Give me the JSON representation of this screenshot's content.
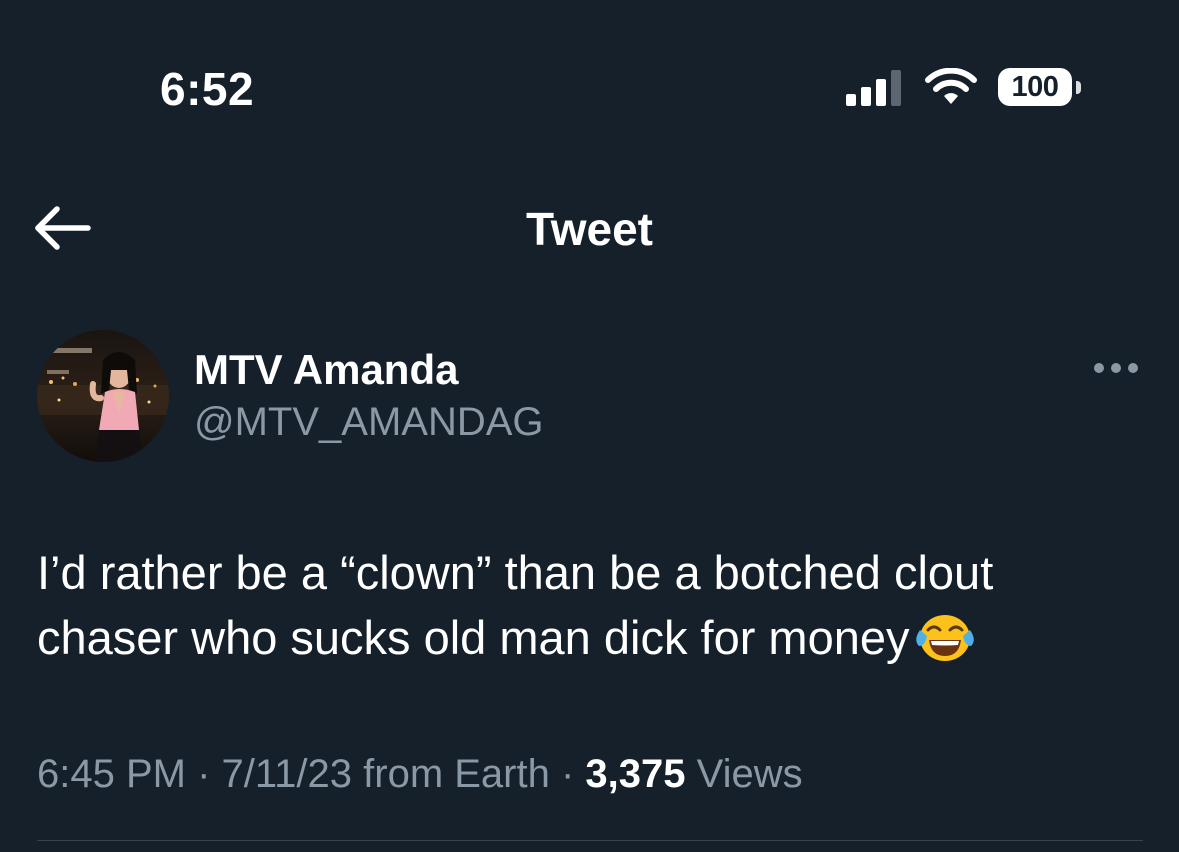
{
  "status_bar": {
    "time": "6:52",
    "battery": "100"
  },
  "header": {
    "title": "Tweet"
  },
  "tweet": {
    "author": {
      "name": "MTV Amanda",
      "handle": "@MTV_AMANDAG"
    },
    "text": "I’d rather be a “clown” than be a botched clout chaser who sucks old man dick for money",
    "emoji": "face-with-tears-of-joy",
    "meta": {
      "time": "6:45 PM",
      "separator": " · ",
      "date": "7/11/23",
      "source": "from Earth",
      "views_count": "3,375",
      "views_label": "Views"
    }
  },
  "colors": {
    "background": "#15202b",
    "text_primary": "#ffffff",
    "text_secondary": "#8b98a5",
    "divider": "#38444d"
  }
}
